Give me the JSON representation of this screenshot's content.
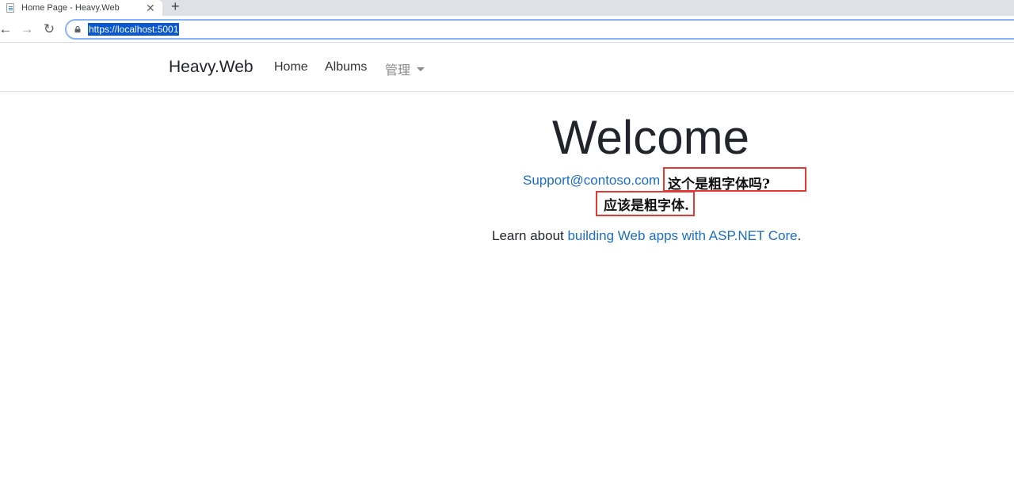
{
  "browser": {
    "tab_title": "Home Page - Heavy.Web",
    "tab_close": "✕",
    "new_tab": "+",
    "url": "https://localhost:5001",
    "back_glyph": "←",
    "forward_glyph": "→",
    "reload_glyph": "↻"
  },
  "navbar": {
    "brand": "Heavy.Web",
    "home": "Home",
    "albums": "Albums",
    "admin_dropdown": "管理"
  },
  "main": {
    "heading": "Welcome",
    "support_email": "Support@contoso.com",
    "bold_question": "这个是粗字体吗?",
    "bold_answer": "应该是粗字体.",
    "learn_prefix": "Learn about ",
    "learn_link": "building Web apps with ASP.NET Core",
    "learn_suffix": "."
  },
  "colors": {
    "link": "#1b6ec2",
    "highlight_border": "#e53935",
    "url_selection": "#0b57d0"
  },
  "icons": {
    "tab_favicon": "page-icon",
    "lock": "lock-icon",
    "caret": "chevron-down-icon"
  }
}
